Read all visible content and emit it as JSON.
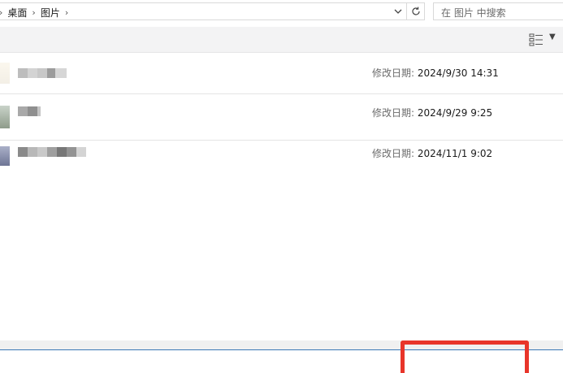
{
  "address_bar": {
    "breadcrumbs": [
      "桌面",
      "图片"
    ],
    "separator": ">"
  },
  "search": {
    "placeholder": "在 图片 中搜索"
  },
  "files": [
    {
      "modified_label": "修改日期:",
      "modified_value": "2024/9/30 14:31"
    },
    {
      "modified_label": "修改日期:",
      "modified_value": "2024/9/29 9:25"
    },
    {
      "modified_label": "修改日期:",
      "modified_value": "2024/11/1 9:02"
    }
  ],
  "colors": {
    "highlight_box": "#e8352a",
    "status_line": "#3b78b5"
  },
  "icons": {
    "view_toggle": "details-view-icon",
    "refresh": "refresh-icon",
    "dropdown": "chevron-down-icon"
  }
}
